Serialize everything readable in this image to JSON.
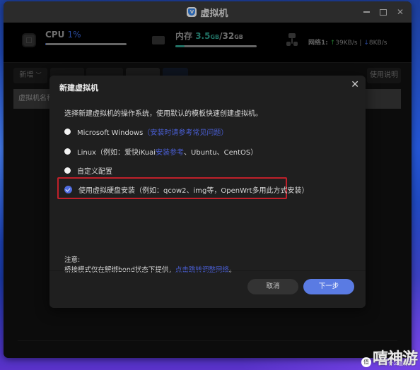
{
  "window": {
    "title": "虚拟机",
    "logo_glyph": "V",
    "controls": {
      "minimize": "minimize-icon",
      "maximize": "maximize-icon",
      "close": "✕"
    }
  },
  "stats": {
    "cpu": {
      "label": "CPU",
      "value": "1%",
      "usage_fraction": 0.01
    },
    "memory": {
      "label": "内存",
      "used": "3.5",
      "used_unit": "GB",
      "separator": "/",
      "total": "32",
      "total_unit": "GB",
      "usage_fraction": 0.11
    },
    "network": {
      "label": "网络1:",
      "up_arrow": "↑",
      "upload": "39KB/s",
      "divider": "|",
      "down_arrow": "↓",
      "download": "8KB/s"
    },
    "colors": {
      "cpu_value": "#3a66d6",
      "memory_value": "#2f9e8c",
      "upload": "#2e9b3c",
      "download": "#3a66d6"
    }
  },
  "toolbar": {
    "add_label": "新增",
    "add_chevron": "﹀",
    "help_label": "使用说明"
  },
  "table": {
    "header_first": "虚拟机名称"
  },
  "modal": {
    "title": "新建虚拟机",
    "close_glyph": "✕",
    "description": "选择新建虚拟机的操作系统，使用默认的模板快速创建虚拟机。",
    "options": [
      {
        "label": "Microsoft Windows",
        "link": "（安装时请参考常见问题）",
        "checked": false
      },
      {
        "label_prefix": "Linux（例如：爱快iKuai",
        "link": "安装参考",
        "label_suffix": "、Ubuntu、CentOS）",
        "checked": false
      },
      {
        "label": "自定义配置",
        "checked": false
      },
      {
        "label": "使用虚拟硬盘安装（例如：qcow2、img等，OpenWrt多用此方式安装）",
        "checked": true
      }
    ],
    "note_title": "注意:",
    "note_text": "桥接模式仅在解绑bond状态下提供，",
    "note_link": "点击跳转调整网络",
    "note_end": "。",
    "cancel_label": "取消",
    "next_label": "下一步",
    "accent_color": "#5a7be3",
    "highlight_color": "#c0202a"
  },
  "watermark": {
    "badge": "值",
    "big": "嘻神游",
    "small": "什么值得买"
  }
}
